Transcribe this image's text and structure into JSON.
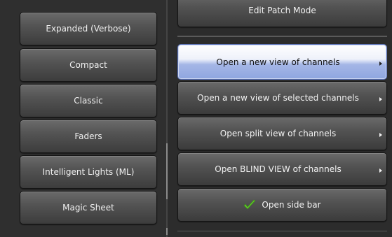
{
  "left_menu": {
    "items": [
      {
        "label": "Expanded (Verbose)"
      },
      {
        "label": "Compact"
      },
      {
        "label": "Classic"
      },
      {
        "label": "Faders"
      },
      {
        "label": "Intelligent Lights (ML)"
      },
      {
        "label": "Magic Sheet"
      }
    ]
  },
  "right_menu": {
    "edit_patch_label": "Edit Patch Mode",
    "items": [
      {
        "label": "Open a new view of channels",
        "has_submenu": true,
        "selected": true
      },
      {
        "label": "Open a new view of selected channels",
        "has_submenu": true
      },
      {
        "label": "Open split view of channels",
        "has_submenu": true
      },
      {
        "label": "Open BLIND VIEW of channels",
        "has_submenu": true
      },
      {
        "label": "Open side bar",
        "icon": "checkmark-icon"
      }
    ]
  },
  "colors": {
    "selected_highlight": "#a4b6e6",
    "checkmark": "#5cc12a"
  }
}
